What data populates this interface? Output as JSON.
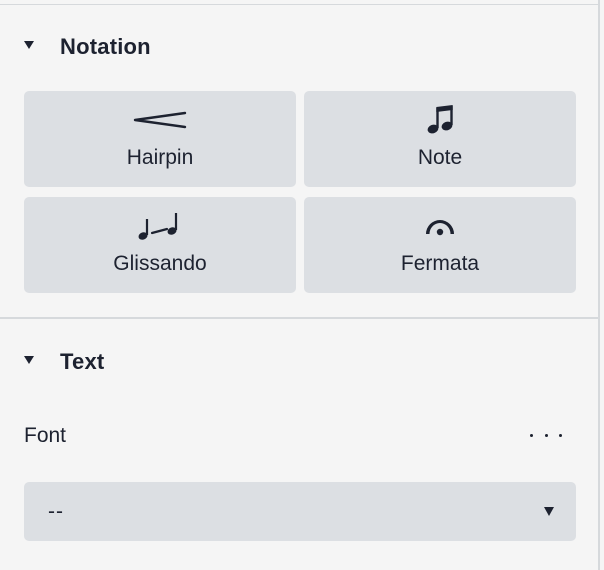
{
  "notation_section": {
    "title": "Notation",
    "tiles": [
      {
        "label": "Hairpin",
        "icon": "hairpin-icon"
      },
      {
        "label": "Note",
        "icon": "beamed-notes-icon"
      },
      {
        "label": "Glissando",
        "icon": "glissando-icon"
      },
      {
        "label": "Fermata",
        "icon": "fermata-icon"
      }
    ]
  },
  "text_section": {
    "title": "Text",
    "font_label": "Font",
    "more_icon": "more-options-icon",
    "font_select": {
      "value": "--",
      "icon": "caret-down-icon"
    }
  },
  "colors": {
    "background": "#f5f5f5",
    "tile_background": "#dcdfe3",
    "divider": "#d6d9dc",
    "text": "#1d2230"
  }
}
